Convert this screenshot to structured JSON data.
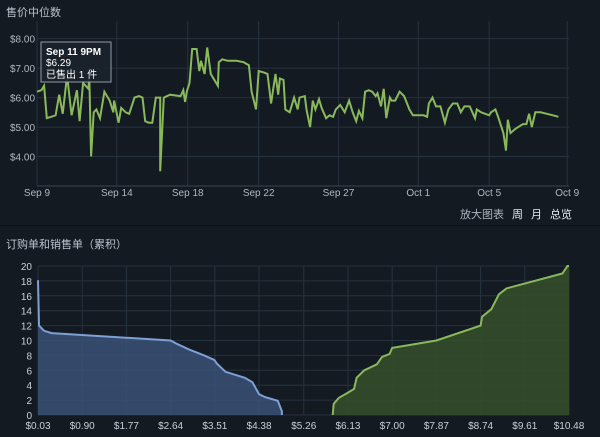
{
  "price_chart": {
    "title": "售价中位数",
    "zoom_label": "放大图表",
    "zoom_options": [
      "周",
      "月",
      "总览"
    ],
    "tooltip": {
      "date": "Sep 11 9PM",
      "price": "$6.29",
      "sold": "已售出 1 件"
    },
    "colors": {
      "line": "#8ab95c",
      "grid": "#26323e",
      "axis_text": "#aeb8c2",
      "background": "#141a22"
    }
  },
  "orders_chart": {
    "title": "订购单和销售单（累积）",
    "colors": {
      "buy": "#7ea0d6",
      "buy_fill": "#3a5276",
      "sell": "#8ab95c",
      "sell_fill": "#35502a"
    }
  },
  "chart_data": [
    {
      "type": "line",
      "title": "售价中位数",
      "x_ticks": [
        "Sep 9",
        "Sep 14",
        "Sep 18",
        "Sep 22",
        "Sep 27",
        "Oct 1",
        "Oct 5",
        "Oct 9"
      ],
      "y_ticks": [
        "$4.00",
        "$5.00",
        "$6.00",
        "$7.00",
        "$8.00"
      ],
      "ylim": [
        3.0,
        8.6
      ],
      "xlim": [
        0,
        30
      ],
      "grid": true,
      "series": [
        {
          "values": [
            [
              0,
              6.2
            ],
            [
              0.25,
              6.25
            ],
            [
              0.4,
              6.4
            ],
            [
              0.55,
              5.3
            ],
            [
              0.8,
              5.35
            ],
            [
              1.05,
              5.4
            ],
            [
              1.25,
              6.1
            ],
            [
              1.45,
              5.45
            ],
            [
              1.7,
              6.75
            ],
            [
              1.95,
              5.4
            ],
            [
              2.25,
              6.25
            ],
            [
              2.4,
              5.2
            ],
            [
              2.6,
              6.5
            ],
            [
              2.9,
              6.3
            ],
            [
              2.95,
              6.7
            ],
            [
              3.05,
              4.0
            ],
            [
              3.2,
              5.5
            ],
            [
              3.35,
              5.6
            ],
            [
              3.55,
              5.3
            ],
            [
              3.8,
              6.2
            ],
            [
              4.1,
              5.9
            ],
            [
              4.3,
              5.5
            ],
            [
              4.35,
              5.9
            ],
            [
              4.6,
              5.15
            ],
            [
              4.75,
              5.65
            ],
            [
              5.0,
              5.5
            ],
            [
              5.2,
              5.45
            ],
            [
              5.5,
              6.0
            ],
            [
              5.75,
              6.05
            ],
            [
              5.95,
              6.0
            ],
            [
              6.1,
              5.2
            ],
            [
              6.3,
              5.15
            ],
            [
              6.5,
              5.15
            ],
            [
              6.7,
              6.0
            ],
            [
              6.95,
              6.0
            ],
            [
              6.95,
              3.5
            ],
            [
              7.15,
              6.0
            ],
            [
              7.5,
              6.1
            ],
            [
              8.1,
              6.05
            ],
            [
              8.25,
              6.25
            ],
            [
              8.35,
              5.85
            ],
            [
              8.45,
              6.2
            ],
            [
              8.6,
              6.5
            ],
            [
              8.75,
              7.65
            ],
            [
              9.0,
              7.65
            ],
            [
              9.15,
              6.9
            ],
            [
              9.25,
              7.25
            ],
            [
              9.45,
              6.8
            ],
            [
              9.6,
              7.7
            ],
            [
              9.8,
              6.8
            ],
            [
              10.2,
              6.4
            ],
            [
              10.25,
              7.2
            ],
            [
              10.45,
              7.3
            ],
            [
              10.75,
              7.25
            ],
            [
              11.25,
              7.25
            ],
            [
              11.65,
              7.2
            ],
            [
              11.95,
              7.1
            ],
            [
              12.1,
              6.2
            ],
            [
              12.35,
              5.6
            ],
            [
              12.5,
              6.9
            ],
            [
              12.8,
              6.85
            ],
            [
              13.0,
              6.8
            ],
            [
              13.2,
              5.8
            ],
            [
              13.35,
              6.4
            ],
            [
              13.45,
              6.8
            ],
            [
              13.6,
              6.1
            ],
            [
              13.7,
              6.65
            ],
            [
              13.9,
              6.6
            ],
            [
              14.0,
              5.6
            ],
            [
              14.25,
              5.5
            ],
            [
              14.5,
              6.0
            ],
            [
              14.7,
              5.6
            ],
            [
              14.8,
              6.0
            ],
            [
              15.1,
              6.05
            ],
            [
              15.2,
              5.6
            ],
            [
              15.4,
              5.0
            ],
            [
              15.55,
              5.9
            ],
            [
              15.7,
              5.6
            ],
            [
              15.9,
              5.95
            ],
            [
              16.05,
              5.65
            ],
            [
              16.3,
              5.3
            ],
            [
              16.5,
              5.4
            ],
            [
              16.7,
              5.35
            ],
            [
              16.85,
              5.6
            ],
            [
              17.1,
              5.75
            ],
            [
              17.35,
              5.5
            ],
            [
              17.6,
              5.9
            ],
            [
              17.8,
              5.5
            ],
            [
              18.0,
              5.2
            ],
            [
              18.15,
              5.55
            ],
            [
              18.35,
              5.3
            ],
            [
              18.5,
              6.2
            ],
            [
              18.7,
              6.25
            ],
            [
              18.9,
              6.2
            ],
            [
              19.1,
              6.05
            ],
            [
              19.2,
              6.15
            ],
            [
              19.4,
              5.7
            ],
            [
              19.55,
              6.3
            ],
            [
              19.7,
              5.3
            ],
            [
              19.9,
              6.0
            ],
            [
              20.0,
              5.9
            ],
            [
              20.2,
              5.9
            ],
            [
              20.45,
              6.2
            ],
            [
              20.7,
              6.05
            ],
            [
              21.0,
              5.6
            ],
            [
              21.2,
              5.4
            ],
            [
              21.5,
              5.4
            ],
            [
              21.8,
              5.4
            ],
            [
              22.0,
              5.35
            ],
            [
              22.1,
              5.8
            ],
            [
              22.3,
              6.0
            ],
            [
              22.5,
              5.7
            ],
            [
              22.75,
              5.7
            ],
            [
              23.0,
              5.15
            ],
            [
              23.2,
              5.6
            ],
            [
              23.45,
              5.8
            ],
            [
              23.7,
              5.8
            ],
            [
              23.9,
              5.5
            ],
            [
              24.1,
              5.7
            ],
            [
              24.4,
              5.7
            ],
            [
              24.7,
              5.3
            ],
            [
              24.8,
              5.6
            ],
            [
              25.05,
              5.5
            ],
            [
              25.5,
              5.4
            ],
            [
              25.6,
              5.5
            ],
            [
              25.85,
              5.6
            ],
            [
              26.0,
              5.35
            ],
            [
              26.3,
              4.8
            ],
            [
              26.45,
              4.2
            ],
            [
              26.55,
              5.25
            ],
            [
              26.7,
              4.8
            ],
            [
              27.0,
              4.95
            ],
            [
              27.4,
              5.1
            ],
            [
              27.6,
              5.1
            ],
            [
              27.75,
              5.45
            ],
            [
              27.9,
              5.0
            ],
            [
              28.1,
              5.5
            ],
            [
              28.4,
              5.5
            ],
            [
              28.75,
              5.45
            ],
            [
              29.1,
              5.4
            ],
            [
              29.4,
              5.35
            ]
          ]
        }
      ]
    },
    {
      "type": "area",
      "title": "订购单和销售单（累积）",
      "x_ticks": [
        "$0.03",
        "$0.90",
        "$1.77",
        "$2.64",
        "$3.51",
        "$4.38",
        "$5.26",
        "$6.13",
        "$7.00",
        "$7.87",
        "$8.74",
        "$9.61",
        "$10.48"
      ],
      "y_ticks": [
        "0",
        "2",
        "4",
        "6",
        "8",
        "10",
        "12",
        "14",
        "16",
        "18",
        "20"
      ],
      "xlim": [
        0.03,
        10.48
      ],
      "ylim": [
        0,
        20
      ],
      "grid": true,
      "series": [
        {
          "values": [
            [
              0.03,
              18.1
            ],
            [
              0.05,
              12.0
            ],
            [
              0.15,
              11.3
            ],
            [
              0.3,
              11.0
            ],
            [
              2.64,
              10.0
            ],
            [
              2.75,
              9.6
            ],
            [
              3.0,
              8.8
            ],
            [
              3.3,
              8.0
            ],
            [
              3.5,
              7.4
            ],
            [
              3.55,
              6.9
            ],
            [
              3.72,
              5.8
            ],
            [
              4.1,
              5.0
            ],
            [
              4.25,
              4.4
            ],
            [
              4.38,
              2.8
            ],
            [
              4.5,
              2.4
            ],
            [
              4.75,
              1.9
            ],
            [
              4.83,
              0.5
            ],
            [
              4.83,
              0
            ]
          ]
        },
        {
          "values": [
            [
              5.83,
              0
            ],
            [
              5.85,
              1.5
            ],
            [
              5.95,
              2.3
            ],
            [
              6.13,
              3.0
            ],
            [
              6.25,
              3.5
            ],
            [
              6.3,
              5.0
            ],
            [
              6.45,
              6.0
            ],
            [
              6.7,
              6.8
            ],
            [
              6.8,
              7.8
            ],
            [
              6.95,
              8.2
            ],
            [
              7.0,
              9.0
            ],
            [
              7.87,
              10.0
            ],
            [
              8.74,
              12.0
            ],
            [
              8.77,
              13.2
            ],
            [
              8.95,
              14.2
            ],
            [
              9.1,
              16.2
            ],
            [
              9.25,
              17.0
            ],
            [
              10.35,
              19.0
            ],
            [
              10.45,
              20.0
            ],
            [
              10.48,
              20.0
            ]
          ]
        }
      ]
    }
  ]
}
